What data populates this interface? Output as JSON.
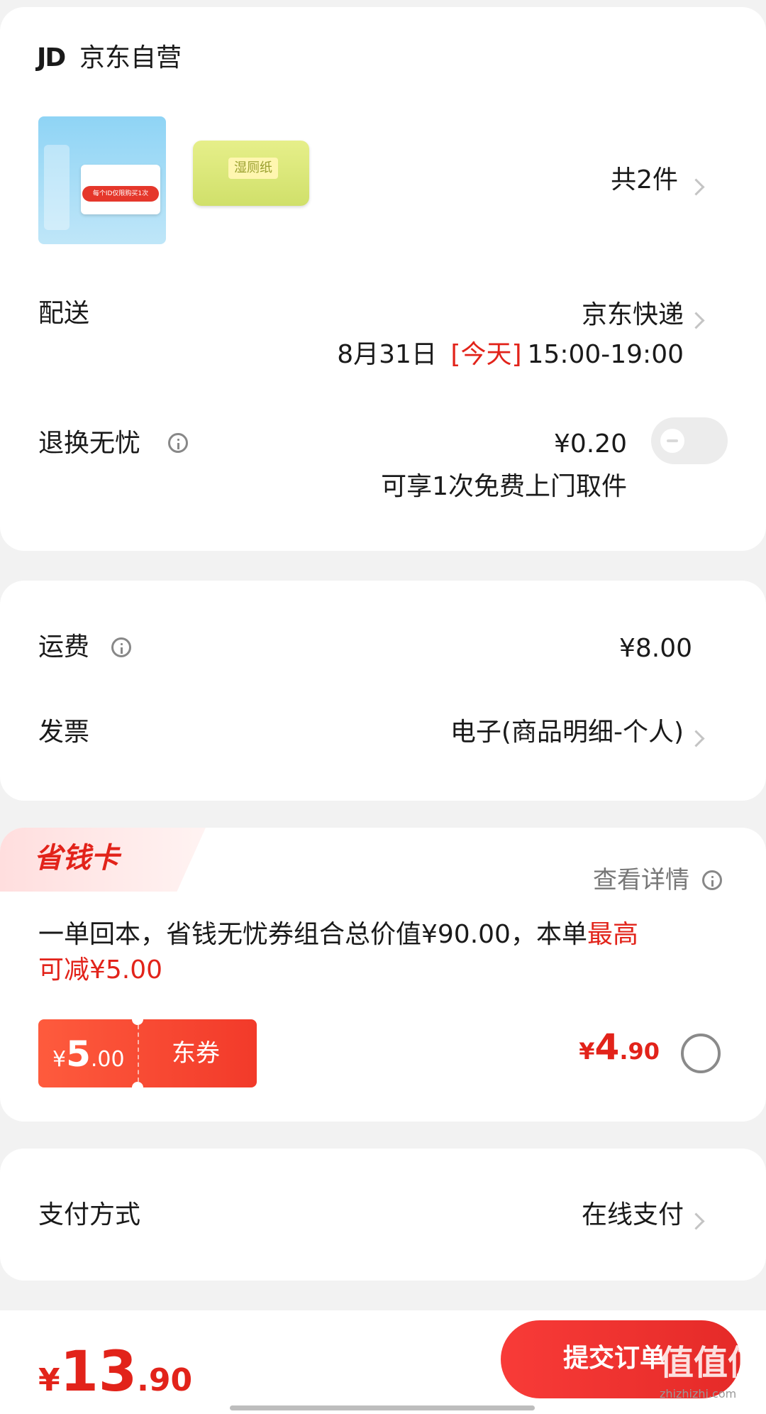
{
  "store": {
    "logo_text": "JD",
    "name": "京东自营"
  },
  "products": {
    "count_label": "共2件",
    "items": [
      {
        "image_icon": "wipes-package-icon",
        "color": "#6cc3ef",
        "image_text": "每个ID仅限购买1次"
      },
      {
        "image_icon": "toilet-paper-package-icon",
        "color": "#d8e76a",
        "image_text": "湿厕纸"
      }
    ]
  },
  "delivery": {
    "label": "配送",
    "method": "京东快递",
    "date": "8月31日",
    "today_tag": "[今天]",
    "time_window": "15:00-19:00"
  },
  "return_insurance": {
    "label": "退换无忧",
    "price": "¥0.20",
    "description": "可享1次免费上门取件",
    "enabled": false
  },
  "shipping": {
    "label": "运费",
    "value": "¥8.00"
  },
  "invoice": {
    "label": "发票",
    "value": "电子(商品明细-个人)"
  },
  "savings_card": {
    "title": "省钱卡",
    "details_link": "查看详情",
    "desc_prefix": "一单回本，省钱无忧券组合总价值¥90.00，本单",
    "desc_highlight_1": "最高",
    "desc_highlight_2": "可减¥5.00",
    "coupon_currency": "¥",
    "coupon_int": "5",
    "coupon_dec": ".00",
    "coupon_type": "东券",
    "price_currency": "¥",
    "price_int": "4",
    "price_dec": ".90",
    "selected": false
  },
  "payment": {
    "label": "支付方式",
    "value": "在线支付"
  },
  "footer": {
    "total_currency": "¥",
    "total_int": "13",
    "total_dec": ".90",
    "submit_label": "提交订单",
    "watermark": "值值值",
    "watermark_url": "zhizhizhi.com"
  },
  "colors": {
    "accent_red": "#e2231a",
    "page_bg": "#f2f2f2"
  }
}
